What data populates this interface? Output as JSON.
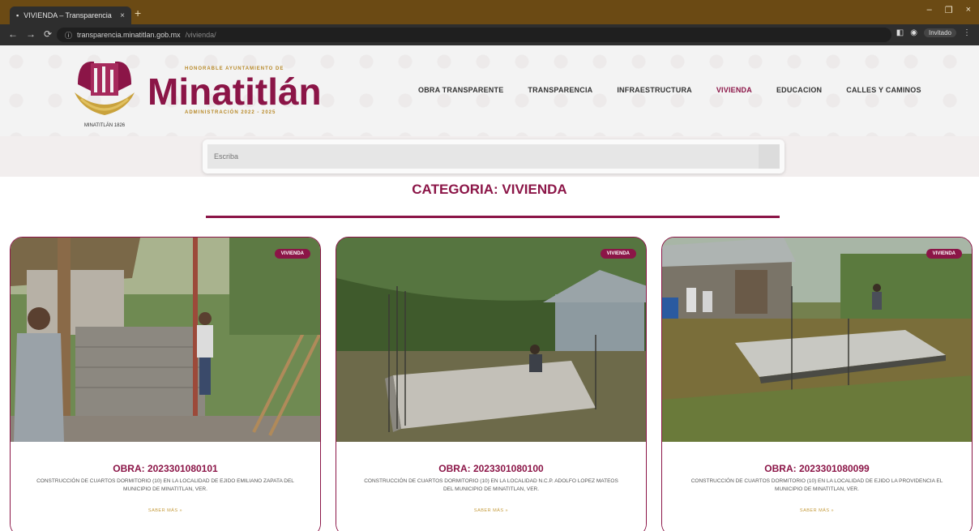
{
  "browser": {
    "tab_title": "VIVIENDA – Transparencia",
    "tab_close": "×",
    "new_tab": "+",
    "url_host": "transparencia.minatitlan.gob.mx",
    "url_rest": "/vivienda/",
    "profile_label": "Invitado",
    "win_min": "–",
    "win_max": "❐",
    "win_close": "×"
  },
  "header": {
    "logo_sub_top": "HONORABLE AYUNTAMIENTO DE",
    "logo_title": "Minatitlán",
    "logo_sub_bottom": "ADMINISTRACIÓN 2022 - 2025",
    "emblem_caption": "MINATITLÁN 1826"
  },
  "nav": {
    "items": [
      {
        "label": "OBRA TRANSPARENTE"
      },
      {
        "label": "TRANSPARENCIA"
      },
      {
        "label": "INFRAESTRUCTURA"
      },
      {
        "label": "VIVIENDA"
      },
      {
        "label": "EDUCACION"
      },
      {
        "label": "CALLES Y CAMINOS"
      }
    ],
    "active": "VIVIENDA"
  },
  "search": {
    "placeholder": "Escriba"
  },
  "category": {
    "title": "CATEGORIA: VIVIENDA"
  },
  "colors": {
    "brand": "#8b1547",
    "gold": "#c49a3a"
  },
  "cards": [
    {
      "badge": "VIVIENDA",
      "title": "OBRA: 2023301080101",
      "description": "CONSTRUCCIÓN DE CUARTOS DORMITORIO (10) EN LA LOCALIDAD DE EJIDO EMILIANO ZAPATA DEL MUNICIPIO DE MINATITLAN, VER.",
      "link": "SABER MÁS »"
    },
    {
      "badge": "VIVIENDA",
      "title": "OBRA: 2023301080100",
      "description": "CONSTRUCCIÓN DE CUARTOS DORMITORIO (10) EN LA LOCALIDAD N.C.P. ADOLFO LOPEZ MATEOS DEL MUNICIPIO DE MINATITLAN, VER.",
      "link": "SABER MÁS »"
    },
    {
      "badge": "VIVIENDA",
      "title": "OBRA: 2023301080099",
      "description": "CONSTRUCCIÓN DE CUARTOS DORMITORIO (10) EN LA LOCALIDAD DE EJIDO LA PROVIDENCIA EL MUNICIPIO DE MINATITLAN, VER.",
      "link": "SABER MÁS »"
    }
  ]
}
